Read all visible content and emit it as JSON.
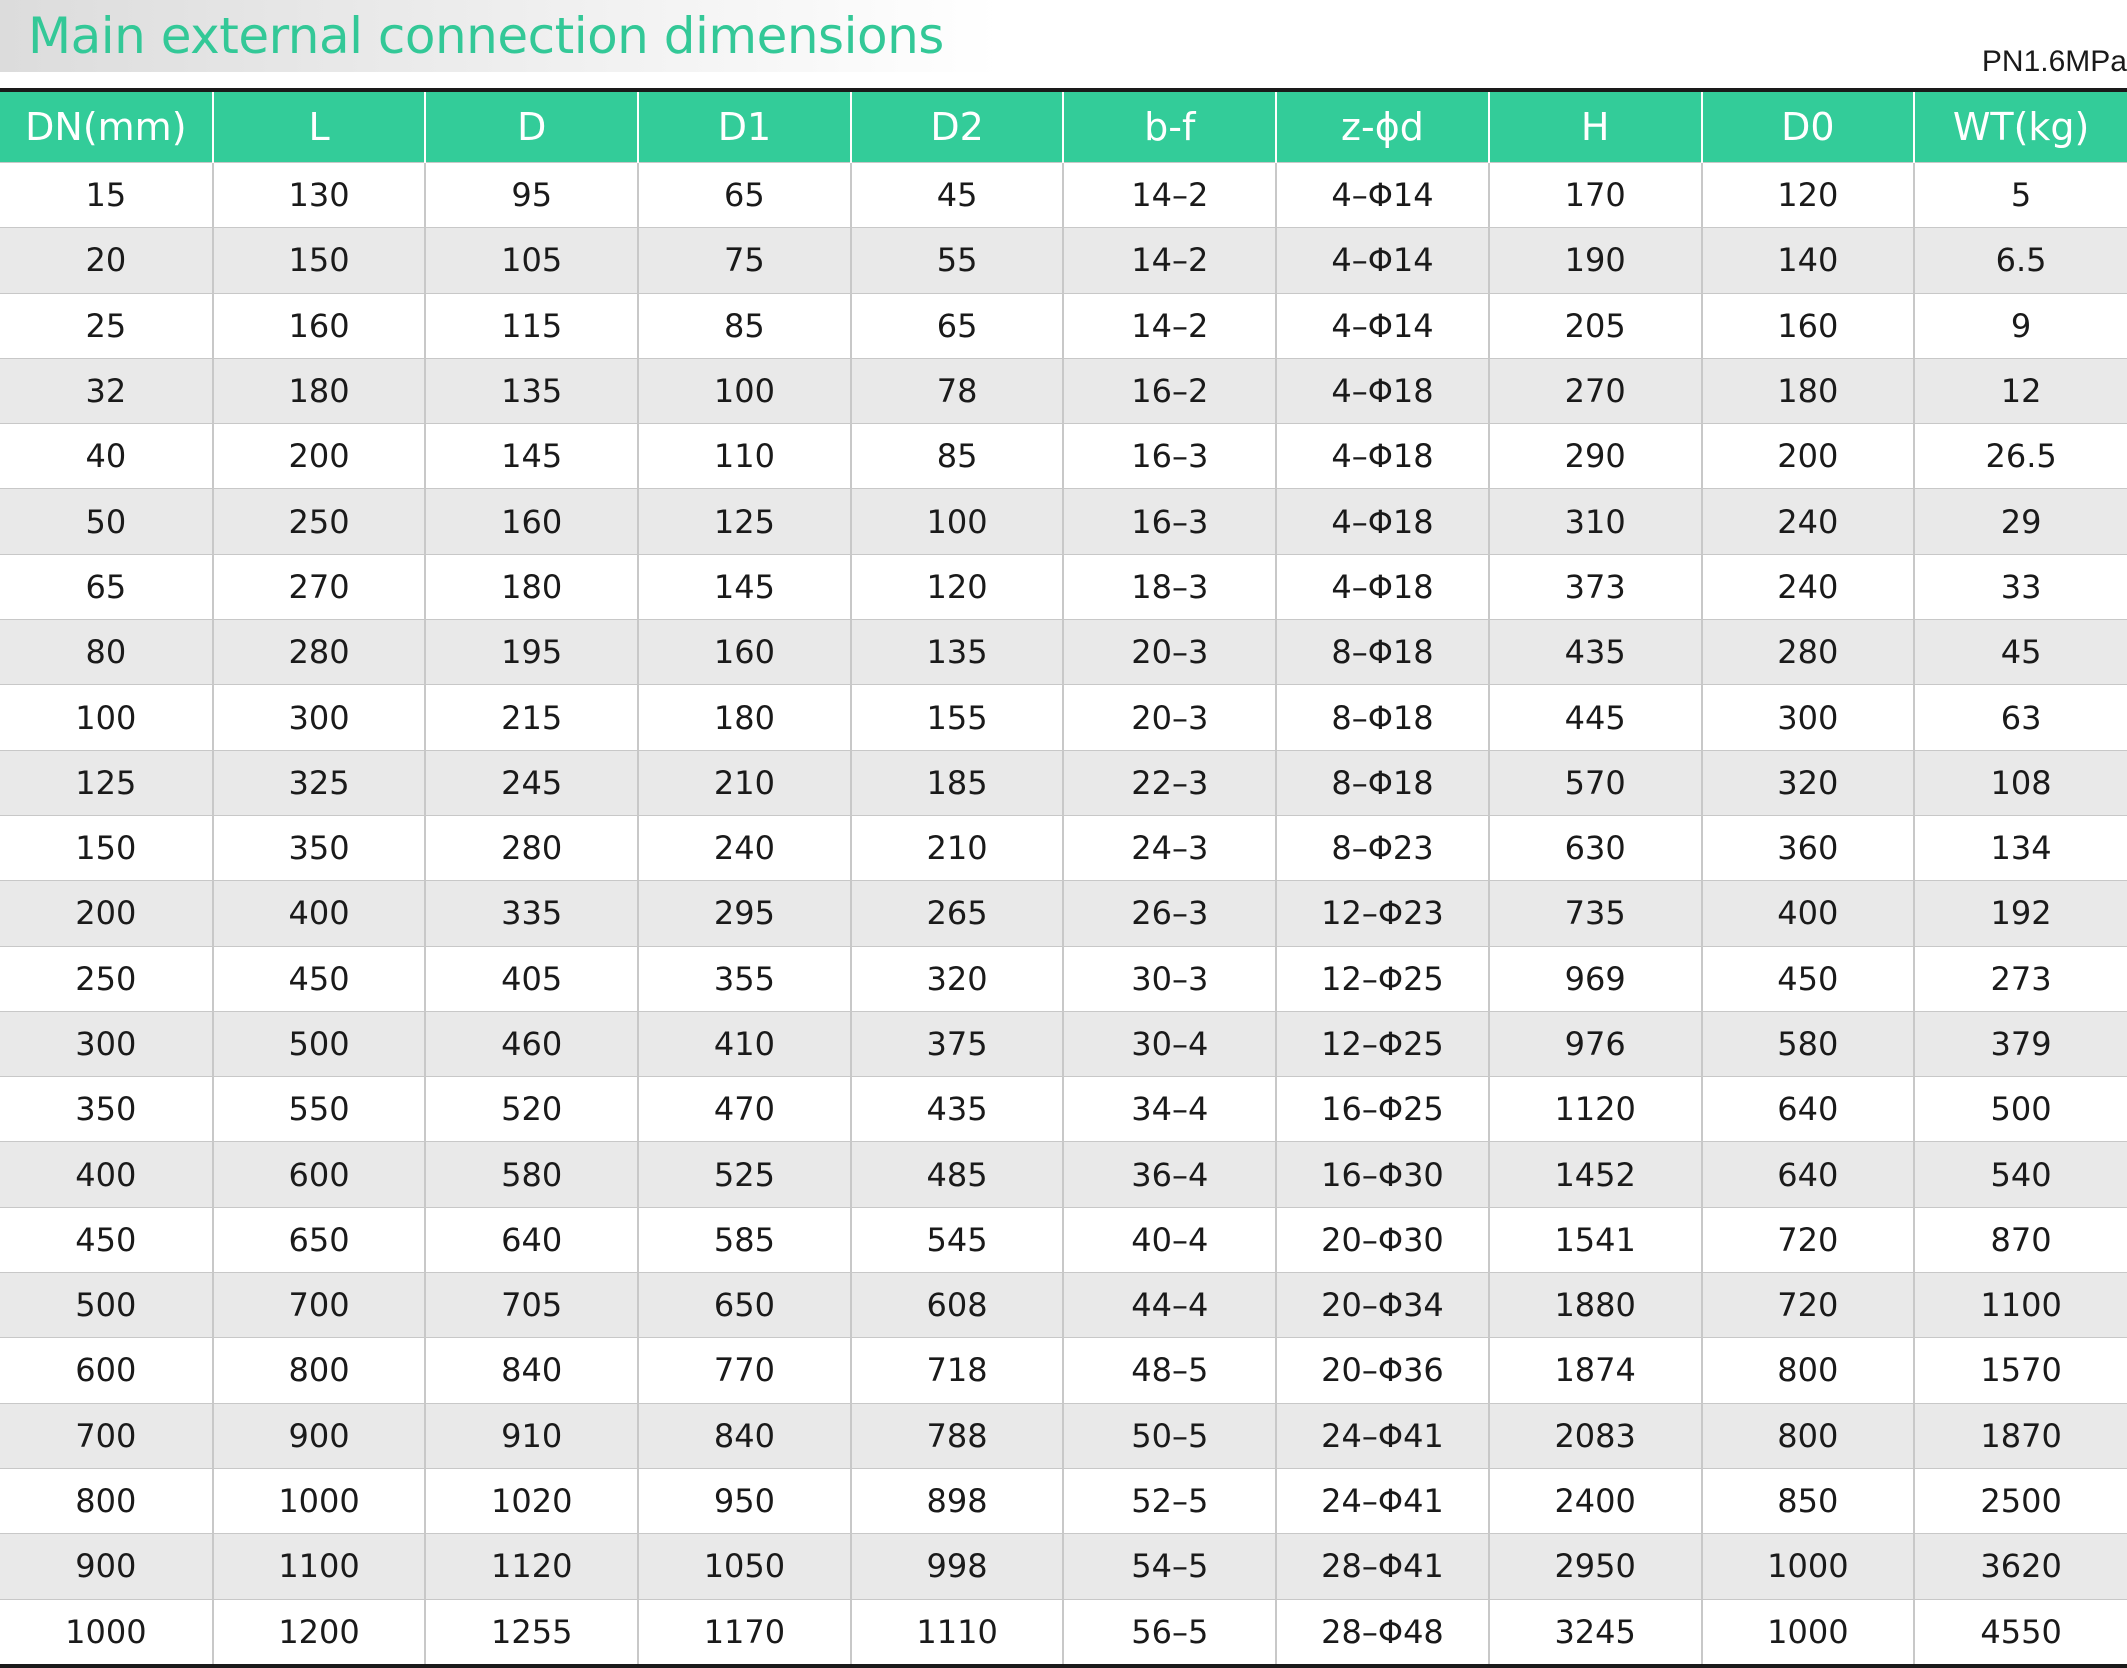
{
  "title": "Main external connection dimensions",
  "pressure": "PN1.6MPa",
  "table": {
    "headers": [
      "DN(mm)",
      "L",
      "D",
      "D1",
      "D2",
      "b-f",
      "z-ϕd",
      "H",
      "D0",
      "WT(kg)"
    ],
    "rows": [
      [
        "15",
        "130",
        "95",
        "65",
        "45",
        "14–2",
        "4–Φ14",
        "170",
        "120",
        "5"
      ],
      [
        "20",
        "150",
        "105",
        "75",
        "55",
        "14–2",
        "4–Φ14",
        "190",
        "140",
        "6.5"
      ],
      [
        "25",
        "160",
        "115",
        "85",
        "65",
        "14–2",
        "4–Φ14",
        "205",
        "160",
        "9"
      ],
      [
        "32",
        "180",
        "135",
        "100",
        "78",
        "16–2",
        "4–Φ18",
        "270",
        "180",
        "12"
      ],
      [
        "40",
        "200",
        "145",
        "110",
        "85",
        "16–3",
        "4–Φ18",
        "290",
        "200",
        "26.5"
      ],
      [
        "50",
        "250",
        "160",
        "125",
        "100",
        "16–3",
        "4–Φ18",
        "310",
        "240",
        "29"
      ],
      [
        "65",
        "270",
        "180",
        "145",
        "120",
        "18–3",
        "4–Φ18",
        "373",
        "240",
        "33"
      ],
      [
        "80",
        "280",
        "195",
        "160",
        "135",
        "20–3",
        "8–Φ18",
        "435",
        "280",
        "45"
      ],
      [
        "100",
        "300",
        "215",
        "180",
        "155",
        "20–3",
        "8–Φ18",
        "445",
        "300",
        "63"
      ],
      [
        "125",
        "325",
        "245",
        "210",
        "185",
        "22–3",
        "8–Φ18",
        "570",
        "320",
        "108"
      ],
      [
        "150",
        "350",
        "280",
        "240",
        "210",
        "24–3",
        "8–Φ23",
        "630",
        "360",
        "134"
      ],
      [
        "200",
        "400",
        "335",
        "295",
        "265",
        "26–3",
        "12–Φ23",
        "735",
        "400",
        "192"
      ],
      [
        "250",
        "450",
        "405",
        "355",
        "320",
        "30–3",
        "12–Φ25",
        "969",
        "450",
        "273"
      ],
      [
        "300",
        "500",
        "460",
        "410",
        "375",
        "30–4",
        "12–Φ25",
        "976",
        "580",
        "379"
      ],
      [
        "350",
        "550",
        "520",
        "470",
        "435",
        "34–4",
        "16–Φ25",
        "1120",
        "640",
        "500"
      ],
      [
        "400",
        "600",
        "580",
        "525",
        "485",
        "36–4",
        "16–Φ30",
        "1452",
        "640",
        "540"
      ],
      [
        "450",
        "650",
        "640",
        "585",
        "545",
        "40–4",
        "20–Φ30",
        "1541",
        "720",
        "870"
      ],
      [
        "500",
        "700",
        "705",
        "650",
        "608",
        "44–4",
        "20–Φ34",
        "1880",
        "720",
        "1100"
      ],
      [
        "600",
        "800",
        "840",
        "770",
        "718",
        "48–5",
        "20–Φ36",
        "1874",
        "800",
        "1570"
      ],
      [
        "700",
        "900",
        "910",
        "840",
        "788",
        "50–5",
        "24–Φ41",
        "2083",
        "800",
        "1870"
      ],
      [
        "800",
        "1000",
        "1020",
        "950",
        "898",
        "52–5",
        "24–Φ41",
        "2400",
        "850",
        "2500"
      ],
      [
        "900",
        "1100",
        "1120",
        "1050",
        "998",
        "54–5",
        "28–Φ41",
        "2950",
        "1000",
        "3620"
      ],
      [
        "1000",
        "1200",
        "1255",
        "1170",
        "1110",
        "56–5",
        "28–Φ48",
        "3245",
        "1000",
        "4550"
      ]
    ]
  },
  "colors": {
    "accent": "#33cc99",
    "title_text": "#33c897",
    "row_stripe": "#e9e9e9"
  }
}
